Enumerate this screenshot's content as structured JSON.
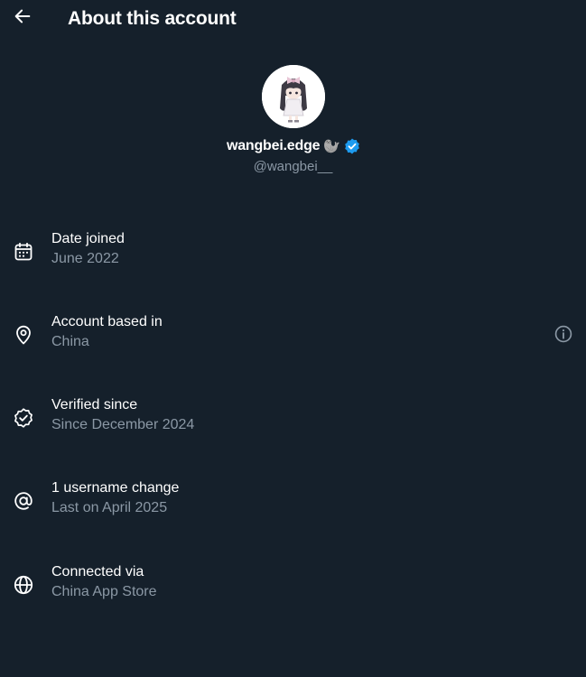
{
  "header": {
    "back_icon": "arrow-left-icon",
    "title": "About this account"
  },
  "profile": {
    "avatar": "avatar-anime-girl",
    "display_name": "wangbei.edge",
    "name_emoji": "🦭",
    "verified_icon": "verified-badge-icon",
    "verified_color": "#1d9bf0",
    "handle": "@wangbei__"
  },
  "details": [
    {
      "icon": "calendar-icon",
      "title": "Date joined",
      "value": "June 2022"
    },
    {
      "icon": "location-pin-icon",
      "title": "Account based in",
      "value": "China",
      "info_icon": "info-icon"
    },
    {
      "icon": "verified-check-icon",
      "title": "Verified since",
      "value": "Since December 2024"
    },
    {
      "icon": "at-sign-icon",
      "title": "1 username change",
      "value": "Last on April 2025"
    },
    {
      "icon": "globe-icon",
      "title": "Connected via",
      "value": "China App Store"
    }
  ],
  "colors": {
    "background": "#15202b",
    "primary_text": "#ffffff",
    "secondary_text": "#8b98a5",
    "accent": "#1d9bf0"
  }
}
